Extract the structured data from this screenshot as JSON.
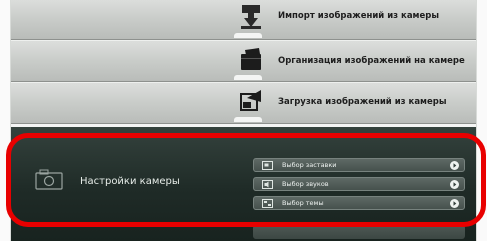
{
  "menu": {
    "items": [
      {
        "label": "Импорт изображений из камеры",
        "icon": "import-icon"
      },
      {
        "label": "Организация изображений на камере",
        "icon": "organize-icon"
      },
      {
        "label": "Загрузка изображений из камеры",
        "icon": "upload-icon"
      }
    ]
  },
  "camera_settings": {
    "title": "Настройки камеры",
    "icon": "camera-icon",
    "options": [
      {
        "label": "Выбор заставки",
        "icon": "startup-image-icon"
      },
      {
        "label": "Выбор звуков",
        "icon": "sound-icon"
      },
      {
        "label": "Выбор темы",
        "icon": "theme-icon"
      }
    ]
  },
  "colors": {
    "highlight": "#e80000",
    "panel_dark": "#1f2b27"
  }
}
